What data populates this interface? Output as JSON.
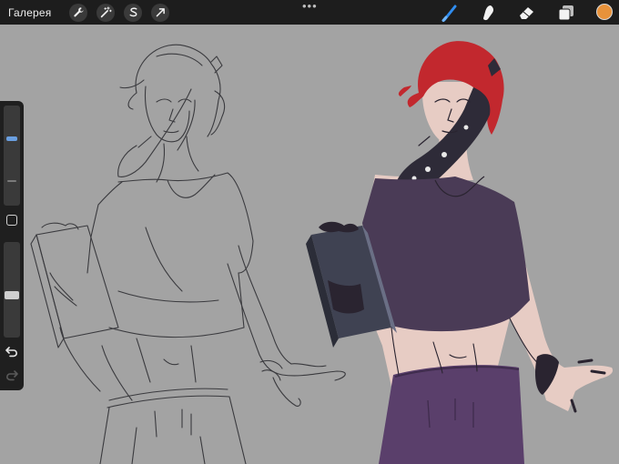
{
  "topbar": {
    "gallery_label": "Галерея",
    "left_tools": [
      "wrench-icon",
      "magic-wand-icon",
      "selection-icon",
      "transform-arrow-icon"
    ],
    "more_label": "•••",
    "right_tools": [
      "brush-icon",
      "smudge-icon",
      "eraser-icon",
      "layers-icon"
    ],
    "active_tool": "brush-icon",
    "color_swatch": "#e8923a",
    "brush_accent": "#2f8df0"
  },
  "sidebar": {
    "brush_size_level": 0.35,
    "opacity_level": 0.55,
    "undo_icon": "undo-icon",
    "redo_icon": "redo-icon"
  },
  "canvas": {
    "background": "#a3a3a3",
    "sketch_color": "#3a3a3e",
    "hair_color": "#c2282e",
    "skin_color": "#e7ccc4",
    "top_color": "#4a3b56",
    "pants_color": "#5a3f6b",
    "book_color": "#3f4252"
  }
}
